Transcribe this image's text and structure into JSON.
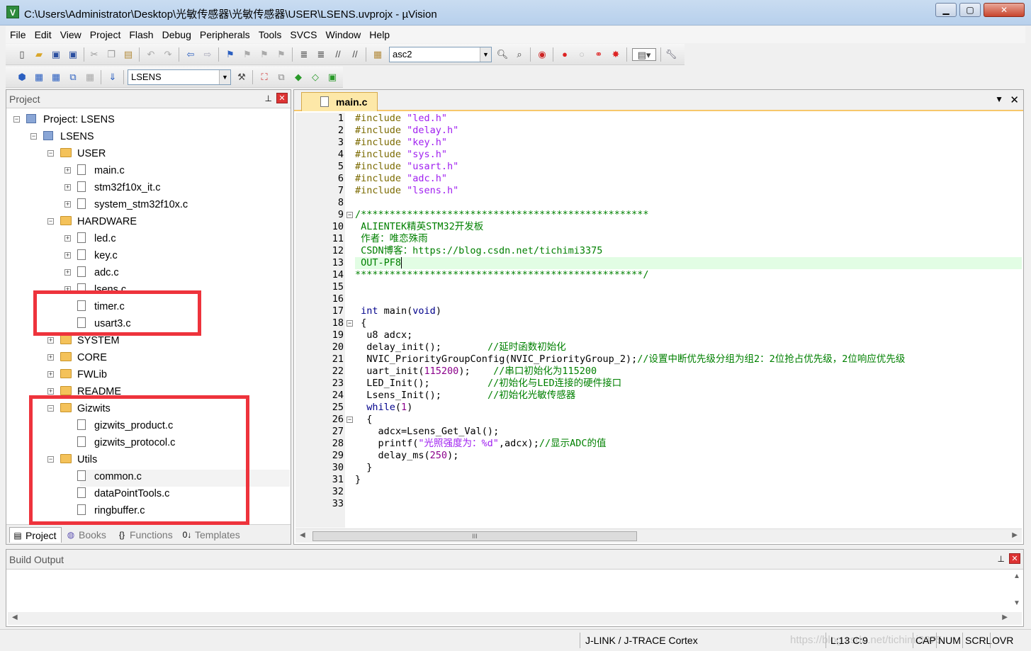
{
  "window": {
    "title": "C:\\Users\\Administrator\\Desktop\\光敏传感器\\光敏传感器\\USER\\LSENS.uvprojx - µVision",
    "min_glyph": "▁",
    "max_glyph": "▢",
    "close_glyph": "✕"
  },
  "menu": [
    "File",
    "Edit",
    "View",
    "Project",
    "Flash",
    "Debug",
    "Peripherals",
    "Tools",
    "SVCS",
    "Window",
    "Help"
  ],
  "toolbar": {
    "find_value": "asc2",
    "target_value": "LSENS"
  },
  "project_panel": {
    "title": "Project",
    "pin_glyph": "⊥",
    "close_glyph": "✕",
    "tree": [
      {
        "label": "Project: LSENS"
      },
      {
        "label": "LSENS"
      },
      {
        "label": "USER"
      },
      {
        "label": "main.c"
      },
      {
        "label": "stm32f10x_it.c"
      },
      {
        "label": "system_stm32f10x.c"
      },
      {
        "label": "HARDWARE"
      },
      {
        "label": "led.c"
      },
      {
        "label": "key.c"
      },
      {
        "label": "adc.c"
      },
      {
        "label": "lsens.c"
      },
      {
        "label": "timer.c"
      },
      {
        "label": "usart3.c"
      },
      {
        "label": "SYSTEM"
      },
      {
        "label": "CORE"
      },
      {
        "label": "FWLib"
      },
      {
        "label": "README"
      },
      {
        "label": "Gizwits"
      },
      {
        "label": "gizwits_product.c"
      },
      {
        "label": "gizwits_protocol.c"
      },
      {
        "label": "Utils"
      },
      {
        "label": "common.c"
      },
      {
        "label": "dataPointTools.c"
      },
      {
        "label": "ringbuffer.c"
      }
    ],
    "tabs": [
      {
        "label": "Project",
        "glyph": "▤"
      },
      {
        "label": "Books",
        "glyph": "◍"
      },
      {
        "label": "Functions",
        "glyph": "{}"
      },
      {
        "label": "Templates",
        "glyph": "0↓"
      }
    ]
  },
  "editor": {
    "tab_label": "main.c",
    "dropdown_glyph": "▼",
    "close_glyph": "✕",
    "line_numbers": [
      "1",
      "2",
      "3",
      "4",
      "5",
      "6",
      "7",
      "8",
      "9",
      "10",
      "11",
      "12",
      "13",
      "14",
      "15",
      "16",
      "17",
      "18",
      "19",
      "20",
      "21",
      "22",
      "23",
      "24",
      "25",
      "26",
      "27",
      "28",
      "29",
      "30",
      "31",
      "32",
      "33"
    ],
    "lines": [
      [
        {
          "t": "#include ",
          "c": "pp"
        },
        {
          "t": "\"led.h\"",
          "c": "str"
        }
      ],
      [
        {
          "t": "#include ",
          "c": "pp"
        },
        {
          "t": "\"delay.h\"",
          "c": "str"
        }
      ],
      [
        {
          "t": "#include ",
          "c": "pp"
        },
        {
          "t": "\"key.h\"",
          "c": "str"
        }
      ],
      [
        {
          "t": "#include ",
          "c": "pp"
        },
        {
          "t": "\"sys.h\"",
          "c": "str"
        }
      ],
      [
        {
          "t": "#include ",
          "c": "pp"
        },
        {
          "t": "\"usart.h\"",
          "c": "str"
        }
      ],
      [
        {
          "t": "#include ",
          "c": "pp"
        },
        {
          "t": "\"adc.h\"",
          "c": "str"
        }
      ],
      [
        {
          "t": "#include ",
          "c": "pp"
        },
        {
          "t": "\"lsens.h\"",
          "c": "str"
        }
      ],
      [],
      [
        {
          "t": "/**************************************************",
          "c": "cmt"
        }
      ],
      [
        {
          "t": " ALIENTEK精英STM32开发板",
          "c": "cmt"
        }
      ],
      [
        {
          "t": " 作者：唯恋殊雨",
          "c": "cmt"
        }
      ],
      [
        {
          "t": " CSDN博客：https://blog.csdn.net/tichimi3375",
          "c": "cmt"
        }
      ],
      [
        {
          "t": " OUT-PF8",
          "c": "cmt"
        }
      ],
      [
        {
          "t": "**************************************************/",
          "c": "cmt"
        }
      ],
      [],
      [],
      [
        {
          "t": " int",
          "c": "kw"
        },
        {
          "t": " main(",
          "c": ""
        },
        {
          "t": "void",
          "c": "kw"
        },
        {
          "t": ")",
          "c": ""
        }
      ],
      [
        {
          "t": " {",
          "c": ""
        }
      ],
      [
        {
          "t": "  u8 adcx;",
          "c": ""
        }
      ],
      [
        {
          "t": "  delay_init();        ",
          "c": ""
        },
        {
          "t": "//延时函数初始化",
          "c": "cmt"
        }
      ],
      [
        {
          "t": "  NVIC_PriorityGroupConfig(NVIC_PriorityGroup_2);",
          "c": ""
        },
        {
          "t": "//设置中断优先级分组为组2：2位抢占优先级，2位响应优先级",
          "c": "cmt"
        }
      ],
      [
        {
          "t": "  uart_init(",
          "c": ""
        },
        {
          "t": "115200",
          "c": "num"
        },
        {
          "t": ");    ",
          "c": ""
        },
        {
          "t": "//串口初始化为115200",
          "c": "cmt"
        }
      ],
      [
        {
          "t": "  LED_Init();          ",
          "c": ""
        },
        {
          "t": "//初始化与LED连接的硬件接口",
          "c": "cmt"
        }
      ],
      [
        {
          "t": "  Lsens_Init();        ",
          "c": ""
        },
        {
          "t": "//初始化光敏传感器",
          "c": "cmt"
        }
      ],
      [
        {
          "t": "  while",
          "c": "kw"
        },
        {
          "t": "(",
          "c": ""
        },
        {
          "t": "1",
          "c": "num"
        },
        {
          "t": ")",
          "c": ""
        }
      ],
      [
        {
          "t": "  {",
          "c": ""
        }
      ],
      [
        {
          "t": "    adcx=Lsens_Get_Val();",
          "c": ""
        }
      ],
      [
        {
          "t": "    printf(",
          "c": ""
        },
        {
          "t": "\"光照强度为：%d\"",
          "c": "str"
        },
        {
          "t": ",adcx);",
          "c": ""
        },
        {
          "t": "//显示ADC的值",
          "c": "cmt"
        }
      ],
      [
        {
          "t": "    delay_ms(",
          "c": ""
        },
        {
          "t": "250",
          "c": "num"
        },
        {
          "t": ");",
          "c": ""
        }
      ],
      [
        {
          "t": "  }",
          "c": ""
        }
      ],
      [
        {
          "t": "}",
          "c": ""
        }
      ],
      [],
      []
    ],
    "current_line": 13,
    "hthumb_glyph": "III"
  },
  "build_output": {
    "title": "Build Output",
    "pin_glyph": "⊥",
    "close_glyph": "✕"
  },
  "status": {
    "debugger": "J-LINK / J-TRACE Cortex",
    "position": "L:13 C:9",
    "cap": "CAP",
    "num": "NUM",
    "scrl": "SCRL",
    "ovr": "OVR",
    "watermark": "https://blog.csdn.net/tichimi3375"
  },
  "colors": {
    "highlight_box": "#ee333c",
    "comment": "#008000",
    "keyword": "#00008b",
    "string": "#a020f0",
    "current_line": "#e2fde4"
  }
}
